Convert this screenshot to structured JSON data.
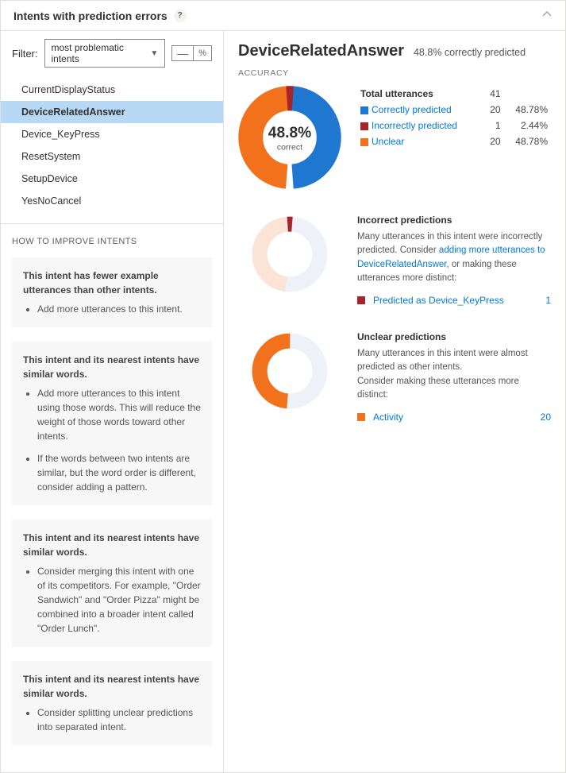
{
  "header": {
    "title": "Intents with prediction errors"
  },
  "filter": {
    "label": "Filter:",
    "selected": "most problematic intents",
    "pct_symbol": "%"
  },
  "intents": [
    {
      "name": "CurrentDisplayStatus",
      "selected": false
    },
    {
      "name": "DeviceRelatedAnswer",
      "selected": true
    },
    {
      "name": "Device_KeyPress",
      "selected": false
    },
    {
      "name": "ResetSystem",
      "selected": false
    },
    {
      "name": "SetupDevice",
      "selected": false
    },
    {
      "name": "YesNoCancel",
      "selected": false
    }
  ],
  "improve": {
    "title": "HOW TO IMPROVE INTENTS",
    "tips": [
      {
        "head": "This intent has fewer example utterances than other intents.",
        "bullets": [
          "Add more utterances to this intent."
        ]
      },
      {
        "head": "This intent and its nearest intents have similar words.",
        "bullets": [
          "Add more utterances to this intent using those words. This will reduce the weight of those words toward other intents.",
          "If the words between two intents are similar, but the word order is different, consider adding a pattern."
        ]
      },
      {
        "head": "This intent and its nearest intents have similar words.",
        "bullets": [
          "Consider merging this intent with one of its competitors. For example, \"Order Sandwich\" and \"Order Pizza\" might be combined into a broader intent called \"Order Lunch\"."
        ]
      },
      {
        "head": "This intent and its nearest intents have similar words.",
        "bullets": [
          "Consider splitting unclear predictions into separated intent."
        ]
      }
    ]
  },
  "detail": {
    "name": "DeviceRelatedAnswer",
    "subtitle": "48.8% correctly predicted",
    "accuracy_label": "ACCURACY",
    "center_pct": "48.8%",
    "center_sub": "correct",
    "total_label": "Total utterances",
    "total_value": "41",
    "rows": [
      {
        "color": "#1f77d0",
        "label": "Correctly predicted",
        "count": "20",
        "pct": "48.78%"
      },
      {
        "color": "#a4262c",
        "label": "Incorrectly predicted",
        "count": "1",
        "pct": "2.44%"
      },
      {
        "color": "#f2711c",
        "label": "Unclear",
        "count": "20",
        "pct": "48.78%"
      }
    ],
    "incorrect": {
      "title": "Incorrect predictions",
      "note_pre": "Many utterances in this intent were incorrectly predicted. Consider ",
      "note_link": "adding more utterances to DeviceRelatedAnswer",
      "note_post": ", or making these utterances more distinct:",
      "items": [
        {
          "color": "#a4262c",
          "label": "Predicted as Device_KeyPress",
          "count": "1"
        }
      ]
    },
    "unclear": {
      "title": "Unclear predictions",
      "note1": "Many utterances in this intent were almost predicted as other intents.",
      "note2": "Consider making these utterances more distinct:",
      "items": [
        {
          "color": "#f2711c",
          "label": "Activity",
          "count": "20"
        }
      ]
    }
  },
  "chart_data": [
    {
      "type": "pie",
      "title": "Accuracy",
      "series": [
        {
          "name": "Correctly predicted",
          "value": 20,
          "pct": 48.78,
          "color": "#1f77d0"
        },
        {
          "name": "Incorrectly predicted",
          "value": 1,
          "pct": 2.44,
          "color": "#a4262c"
        },
        {
          "name": "Unclear",
          "value": 20,
          "pct": 48.78,
          "color": "#f2711c"
        }
      ],
      "center_label": "48.8% correct",
      "total": 41
    },
    {
      "type": "pie",
      "title": "Incorrect predictions",
      "series": [
        {
          "name": "Predicted as Device_KeyPress",
          "value": 1,
          "color": "#a4262c"
        },
        {
          "name": "Other",
          "value": 40,
          "color": "#e7eef6"
        }
      ]
    },
    {
      "type": "pie",
      "title": "Unclear predictions",
      "series": [
        {
          "name": "Activity",
          "value": 20,
          "color": "#f2711c"
        },
        {
          "name": "Other",
          "value": 21,
          "color": "#e7eef6"
        }
      ]
    }
  ]
}
